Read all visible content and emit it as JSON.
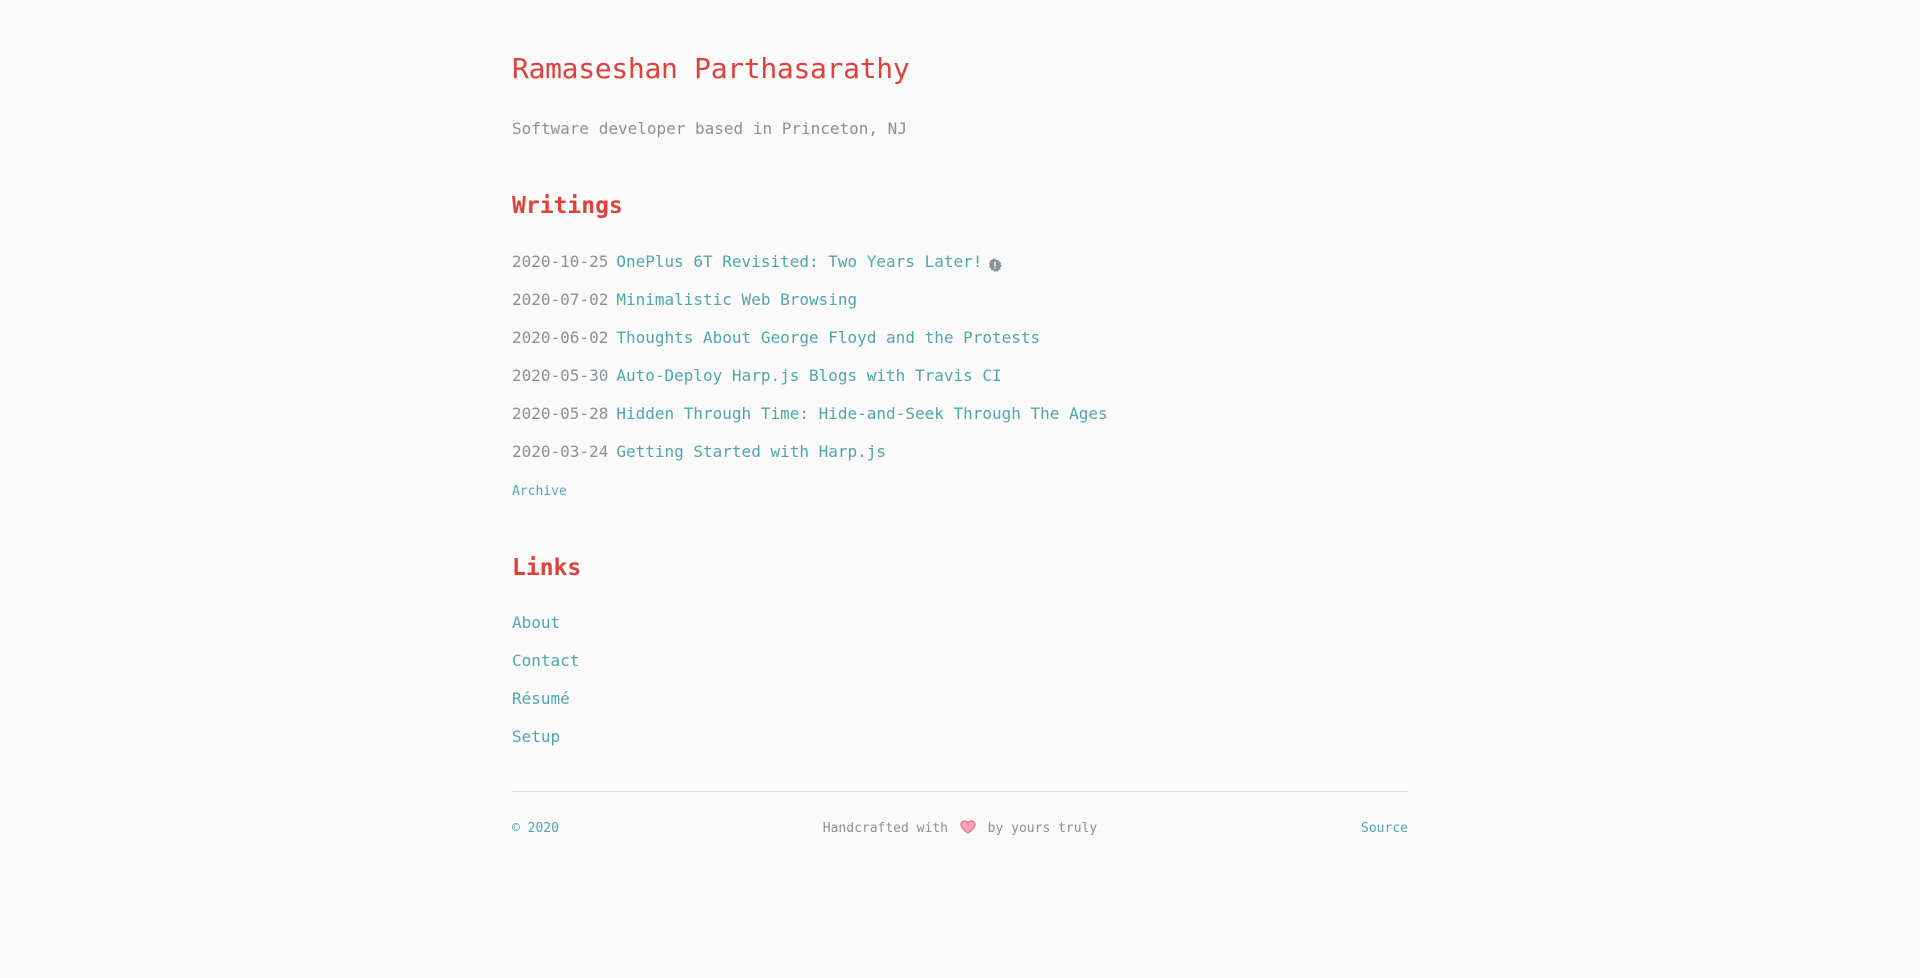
{
  "header": {
    "title": "Ramaseshan Parthasarathy",
    "tagline": "Software developer based in Princeton, NJ"
  },
  "writings": {
    "heading": "Writings",
    "posts": [
      {
        "date": "2020-10-25",
        "title": "OnePlus 6T Revisited: Two Years Later!",
        "icon": "badge-icon"
      },
      {
        "date": "2020-07-02",
        "title": "Minimalistic Web Browsing"
      },
      {
        "date": "2020-06-02",
        "title": "Thoughts About George Floyd and the Protests"
      },
      {
        "date": "2020-05-30",
        "title": "Auto-Deploy Harp.js Blogs with Travis CI"
      },
      {
        "date": "2020-05-28",
        "title": "Hidden Through Time: Hide-and-Seek Through The Ages"
      },
      {
        "date": "2020-03-24",
        "title": "Getting Started with Harp.js"
      }
    ],
    "archive_label": "Archive"
  },
  "links": {
    "heading": "Links",
    "items": [
      {
        "label": "About"
      },
      {
        "label": "Contact"
      },
      {
        "label": "Résumé"
      },
      {
        "label": "Setup"
      }
    ]
  },
  "footer": {
    "copyright": "© 2020",
    "handcrafted_prefix": "Handcrafted with",
    "handcrafted_suffix": "by yours truly",
    "heart_icon": "heart-icon",
    "source_label": "Source"
  },
  "colors": {
    "accent_red": "#e0403a",
    "link_teal": "#4fa6ad",
    "muted_gray": "#8a9196",
    "heart_pink": "#f06c8c",
    "background": "#fafafa"
  }
}
